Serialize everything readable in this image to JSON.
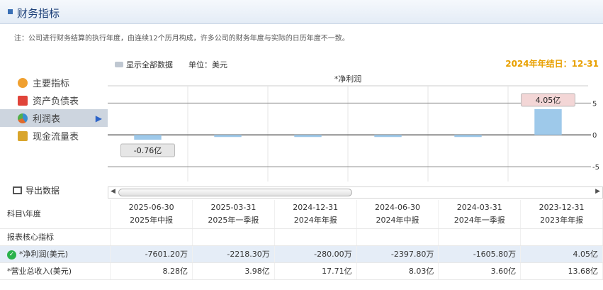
{
  "header": {
    "title": "财务指标"
  },
  "note": "注：公司进行财务结算的执行年度，由连续12个历月构成，许多公司的财务年度与实际的日历年度不一致。",
  "options": {
    "show_all": "显示全部数据",
    "unit": "单位：美元"
  },
  "fiscal_year_end": "2024年年结日：12-31",
  "sidebar": {
    "items": [
      {
        "label": "主要指标",
        "icon": "sun-icon",
        "color": "#f0a030"
      },
      {
        "label": "资产负债表",
        "icon": "document-icon",
        "color": "#e0443a"
      },
      {
        "label": "利润表",
        "icon": "globe-icon",
        "color": "#3a8fd0",
        "active": true
      },
      {
        "label": "现金流量表",
        "icon": "coins-icon",
        "color": "#d9a52c"
      }
    ]
  },
  "export_label": "导出数据",
  "chart_data": {
    "type": "bar",
    "title": "*净利润",
    "categories": [
      "2025-06-30",
      "2025-03-31",
      "2024-12-31",
      "2024-06-30",
      "2024-03-31",
      "2023-12-31"
    ],
    "values": [
      -0.76012,
      -0.22183,
      -0.028,
      -0.23978,
      -0.16058,
      4.05
    ],
    "data_labels": [
      "-0.76亿",
      "",
      "",
      "",
      "",
      "4.05亿"
    ],
    "yticks": [
      "5",
      "0",
      "-5"
    ],
    "ylim": [
      -7,
      7.5
    ],
    "bar_color": "#9ec9ea",
    "grid": true
  },
  "table": {
    "header_label": "科目\\年度",
    "columns": [
      {
        "date": "2025-06-30",
        "type": "2025年中报"
      },
      {
        "date": "2025-03-31",
        "type": "2025年一季报"
      },
      {
        "date": "2024-12-31",
        "type": "2024年年报"
      },
      {
        "date": "2024-06-30",
        "type": "2024年中报"
      },
      {
        "date": "2024-03-31",
        "type": "2024年一季报"
      },
      {
        "date": "2023-12-31",
        "type": "2023年年报"
      }
    ],
    "section": "报表核心指标",
    "rows": [
      {
        "label": "*净利润(美元)",
        "values": [
          "-7601.20万",
          "-2218.30万",
          "-280.00万",
          "-2397.80万",
          "-1605.80万",
          "4.05亿"
        ]
      },
      {
        "label": "*营业总收入(美元)",
        "values": [
          "8.28亿",
          "3.98亿",
          "17.71亿",
          "8.03亿",
          "3.60亿",
          "13.68亿"
        ]
      }
    ]
  }
}
